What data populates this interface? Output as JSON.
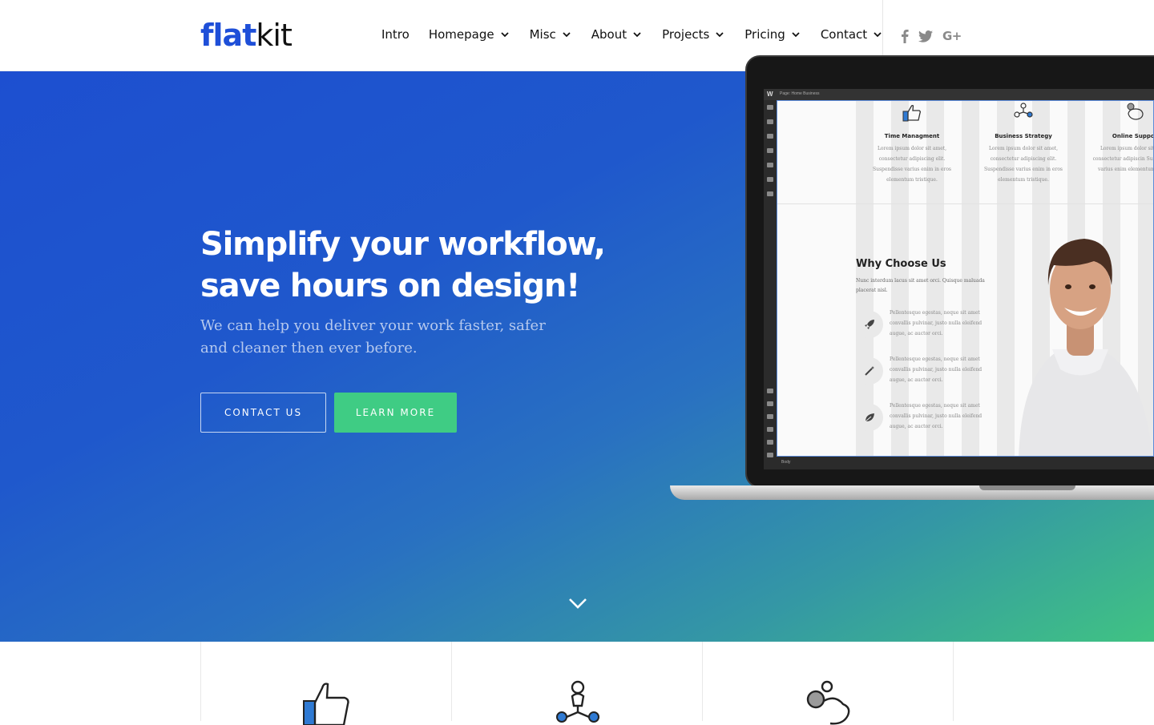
{
  "brand": {
    "part1": "flat",
    "part2": "kit",
    "color": "#1e4fd8"
  },
  "nav": {
    "items": [
      {
        "label": "Intro",
        "has_dropdown": false
      },
      {
        "label": "Homepage",
        "has_dropdown": true
      },
      {
        "label": "Misc",
        "has_dropdown": true
      },
      {
        "label": "About",
        "has_dropdown": true
      },
      {
        "label": "Projects",
        "has_dropdown": true
      },
      {
        "label": "Pricing",
        "has_dropdown": true
      },
      {
        "label": "Contact",
        "has_dropdown": true
      }
    ]
  },
  "social": {
    "icons": [
      "facebook-icon",
      "twitter-icon",
      "google-plus-icon"
    ],
    "gplus_label": "G+"
  },
  "hero": {
    "title_line1": "Simplify your workflow,",
    "title_line2": "save hours on design!",
    "subtitle": "We can help you deliver your work faster, safer and cleaner then ever before.",
    "primary_button": "CONTACT US",
    "secondary_button": "LEARN MORE",
    "gradient_start": "#1d4fd0",
    "gradient_end": "#40c383",
    "scroll_icon": "chevron-down-icon"
  },
  "mockup": {
    "editor_crumb": "Page: Home Business",
    "body_tag": "Body",
    "services": [
      {
        "title": "Time Managment",
        "text": "Lorem ipsum dolor sit amet, consectetur adipiscing elit. Suspendisse varius enim in eros elementum tristique.",
        "icon": "thumbs-up-icon"
      },
      {
        "title": "Business Strategy",
        "text": "Lorem ipsum dolor sit amet, consectetur adipiscing elit. Suspendisse varius enim in eros elementum tristique.",
        "icon": "network-people-icon"
      },
      {
        "title": "Online Suppor",
        "text": "Lorem ipsum dolor sit amet, consectetur adipiscin Suspendisse varius enim elementum tristiq",
        "icon": "piggy-bank-icon"
      }
    ],
    "why_title": "Why Choose Us",
    "why_subtitle": "Nunc interdum lacus sit amet orci. Quisque maluada placerat nisl.",
    "features": [
      {
        "icon": "rocket-icon",
        "text": "Pellentesque egestas, neque sit amet convallis pulvinar, justo nulla eleifend augue, ac auctor orci."
      },
      {
        "icon": "magic-wand-icon",
        "text": "Pellentesque egestas, neque sit amet convallis pulvinar, justo nulla eleifend augue, ac auctor orci."
      },
      {
        "icon": "leaf-icon",
        "text": "Pellentesque egestas, neque sit amet convallis pulvinar, justo nulla eleifend augue, ac auctor orci."
      }
    ]
  },
  "feature_strip": {
    "icons": [
      "thumbs-up-icon",
      "network-people-icon",
      "piggy-bank-icon"
    ]
  }
}
